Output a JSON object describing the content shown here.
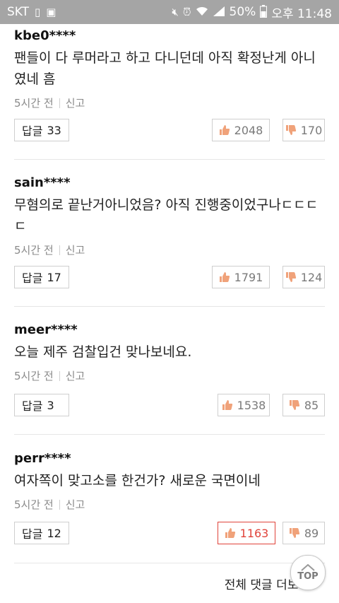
{
  "status_bar": {
    "carrier": "SKT",
    "battery": "50%",
    "time": "오후 11:48",
    "icons": [
      "sim-icon",
      "image-icon",
      "mute-icon",
      "alarm-icon",
      "wifi-icon",
      "signal-icon",
      "battery-icon"
    ]
  },
  "comments": [
    {
      "author": "kbe0****",
      "text": "팬들이 다 루머라고 하고 다니던데 아직 확정난게 아니였네 흠",
      "time": "5시간 전",
      "report": "신고",
      "reply_label": "답글",
      "reply_count": "33",
      "likes": "2048",
      "dislikes": "170",
      "like_active": false
    },
    {
      "author": "sain****",
      "text": "무혐의로 끝난거아니었음? 아직 진행중이었구나ㄷㄷㄷㄷ",
      "time": "5시간 전",
      "report": "신고",
      "reply_label": "답글",
      "reply_count": "17",
      "likes": "1791",
      "dislikes": "124",
      "like_active": false
    },
    {
      "author": "meer****",
      "text": "오늘 제주 검찰입건 맞나보네요.",
      "time": "5시간 전",
      "report": "신고",
      "reply_label": "답글",
      "reply_count": "3",
      "likes": "1538",
      "dislikes": "85",
      "like_active": false
    },
    {
      "author": "perr****",
      "text": "여자쪽이 맞고소를 한건가? 새로운 국면이네",
      "time": "5시간 전",
      "report": "신고",
      "reply_label": "답글",
      "reply_count": "12",
      "likes": "1163",
      "dislikes": "89",
      "like_active": true
    }
  ],
  "footer": {
    "more_label": "전체 댓글 더보기",
    "top_label": "TOP"
  },
  "colors": {
    "status_bar": "#a5a5a5",
    "active_like": "#e0433a",
    "border": "#cfcfcf"
  }
}
